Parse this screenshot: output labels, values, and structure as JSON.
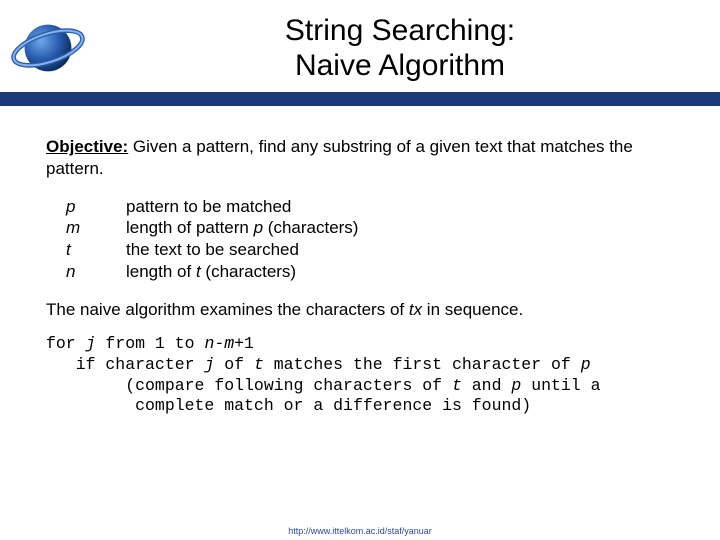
{
  "header": {
    "title_line1": "String Searching:",
    "title_line2": "Naive Algorithm"
  },
  "objective": {
    "label": "Objective:",
    "text": "  Given a pattern, find any substring of a given text that matches the pattern."
  },
  "definitions": [
    {
      "symbol": "p",
      "desc_pre": "pattern to be matched",
      "ital": "",
      "desc_post": ""
    },
    {
      "symbol": "m",
      "desc_pre": "length of pattern ",
      "ital": "p",
      "desc_post": " (characters)"
    },
    {
      "symbol": "t",
      "desc_pre": "the text to be searched",
      "ital": "",
      "desc_post": ""
    },
    {
      "symbol": "n",
      "desc_pre": "length of ",
      "ital": "t",
      "desc_post": " (characters)"
    }
  ],
  "examine": {
    "pre": "The naive algorithm examines the characters of ",
    "ital": "tx",
    "post": " in sequence."
  },
  "code": {
    "l1a": "for ",
    "l1b": "j",
    "l1c": " from 1 to ",
    "l1d": "n-m",
    "l1e": "+1",
    "l2a": "   if character ",
    "l2b": "j",
    "l2c": " of ",
    "l2d": "t",
    "l2e": " matches the first character of ",
    "l2f": "p",
    "l3a": "        (compare following characters of ",
    "l3b": "t",
    "l3c": " and ",
    "l3d": "p",
    "l3e": " until a",
    "l4": "         complete match or a difference is found)"
  },
  "footer": {
    "url": "http://www.ittelkom.ac.id/staf/yanuar"
  }
}
